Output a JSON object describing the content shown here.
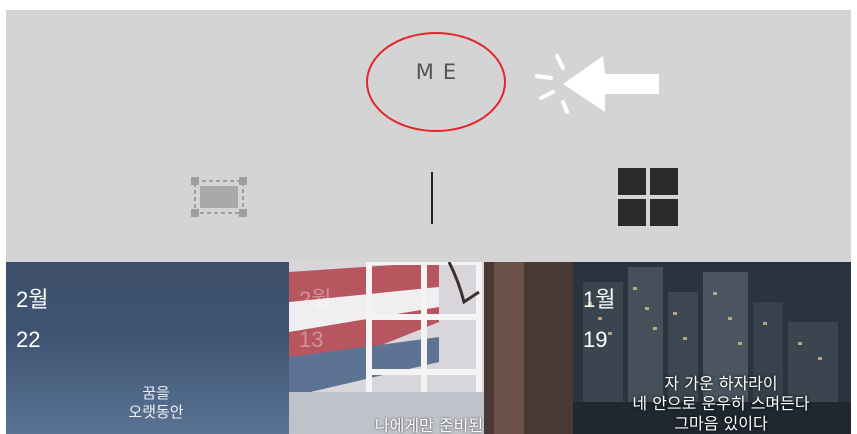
{
  "tabs": {
    "me_label": "ME"
  },
  "view_toggle": {
    "single_icon": "single-view-icon",
    "grid_icon": "grid-view-icon"
  },
  "annotation": {
    "circle_color": "#e2252b",
    "pointer_icon": "pointer-arrow-icon"
  },
  "feed": {
    "items": [
      {
        "month": "2월",
        "day": "22",
        "caption_lines": [
          "꿈을",
          "오랫동안"
        ]
      },
      {
        "month": "2월",
        "day": "13",
        "caption_lines": [
          "나에게만 준비된"
        ]
      },
      {
        "month": "1월",
        "day": "19",
        "caption_lines": [
          "자 가운 하자라이",
          "네 안으로 운우히 스며든다",
          "그마음 있이다"
        ]
      }
    ]
  }
}
